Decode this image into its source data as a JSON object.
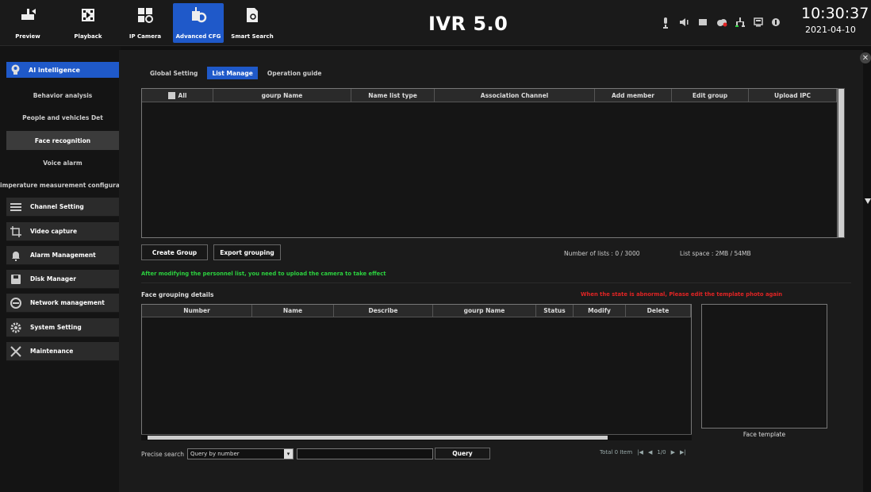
{
  "brand": "IVR 5.0",
  "clock": {
    "time": "10:30:37",
    "date": "2021-04-10"
  },
  "nav": [
    {
      "label": "Preview",
      "icon": "preview-icon"
    },
    {
      "label": "Playback",
      "icon": "playback-icon"
    },
    {
      "label": "IP Camera",
      "icon": "ip-camera-icon"
    },
    {
      "label": "Advanced CFG",
      "icon": "advanced-cfg-icon",
      "active": true
    },
    {
      "label": "Smart Search",
      "icon": "smart-search-icon"
    }
  ],
  "tray": [
    "microphone-icon",
    "speaker-icon",
    "record-icon",
    "cloud-icon",
    "network-icon",
    "monitor-icon",
    "info-icon"
  ],
  "sidebar": {
    "header": "AI intelligence",
    "subitems": [
      "Behavior analysis",
      "People and vehicles Det",
      "Face recognition",
      "Voice alarm",
      "imperature measurement configuratio"
    ],
    "items": [
      "Channel Setting",
      "Video capture",
      "Alarm Management",
      "Disk Manager",
      "Network management",
      "System Setting",
      "Maintenance"
    ]
  },
  "tabs": [
    "Global Setting",
    "List Manage",
    "Operation guide"
  ],
  "group_table": {
    "all_label": "All",
    "columns": [
      "gourp Name",
      "Name list type",
      "Association Channel",
      "Add member",
      "Edit group",
      "Upload IPC"
    ]
  },
  "buttons": {
    "create_group": "Create Group",
    "export_grouping": "Export grouping",
    "query": "Query"
  },
  "stats": {
    "lists": "Number of lists :  0 / 3000",
    "space": "List space :  2MB / 54MB"
  },
  "notice": "After modifying the personnel list, you need to upload the camera to take effect",
  "face_group": {
    "title": "Face grouping details",
    "warning": "When the state is abnormal, Please edit the template photo again",
    "columns": [
      "Number",
      "Name",
      "Describe",
      "gourp Name",
      "Status",
      "Modify",
      "Delete"
    ],
    "template_label": "Face template"
  },
  "search": {
    "label": "Precise search",
    "selected": "Query by number",
    "total": "Total 0 Item",
    "page": "1/0"
  },
  "colors": {
    "accent": "#1f59c9",
    "notice": "#2cd13f",
    "warning": "#e02424"
  }
}
